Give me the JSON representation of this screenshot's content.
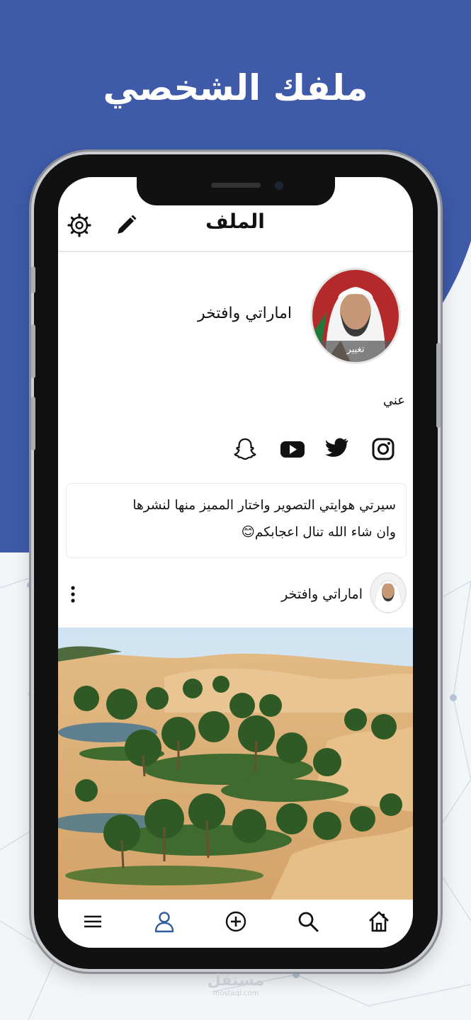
{
  "banner": {
    "title": "ملفك الشخصي"
  },
  "header": {
    "title": "الملف",
    "settings_icon": "gear-icon",
    "edit_icon": "pencil-icon"
  },
  "profile": {
    "name": "اماراتي وافتخر",
    "change_photo_label": "تغيير",
    "about_label": "عني",
    "social_icons": [
      "instagram-icon",
      "twitter-icon",
      "youtube-icon",
      "snapchat-icon"
    ],
    "bio_line_1": "سيرتي  هوايتي التصوير واختار المميز منها لنشرها",
    "bio_line_2": "وان شاء الله تنال اعجابكم😊"
  },
  "post": {
    "author": "اماراتي وافتخر",
    "more_icon": "more-vertical-icon"
  },
  "bottom_nav": [
    {
      "icon": "home-icon",
      "active": false
    },
    {
      "icon": "search-icon",
      "active": false
    },
    {
      "icon": "add-circle-icon",
      "active": false
    },
    {
      "icon": "profile-icon",
      "active": true
    },
    {
      "icon": "menu-icon",
      "active": false
    }
  ],
  "watermark": {
    "main": "مستقل",
    "sub": "mostaql.com"
  },
  "colors": {
    "brand_blue": "#3e5aa8",
    "active_nav": "#2f5d9e",
    "text": "#111111"
  }
}
